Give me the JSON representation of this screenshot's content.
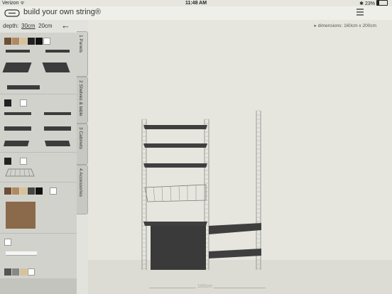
{
  "status": {
    "carrier": "Verizon",
    "time": "11:48 AM",
    "battery": "23%",
    "battery_fraction": 0.23
  },
  "app": {
    "title": "build your own string®"
  },
  "sidebar": {
    "depth_label": "depth:",
    "depth_options": [
      "30cm",
      "20cm"
    ],
    "selected_depth": "30cm"
  },
  "tabs": [
    {
      "label": "1 Panels"
    },
    {
      "label": "2 Shelves & table"
    },
    {
      "label": "3 Cabinets"
    },
    {
      "label": "4 Accessories"
    }
  ],
  "canvas": {
    "dimensions": "dimensions: 160cm x 200cm",
    "width_label": "160cm"
  },
  "colors": {
    "accent": "#3c3c3c",
    "wood": "#8a6a4a",
    "background": "#e6e6df"
  },
  "icons": {
    "back": "back-arrow-icon",
    "menu": "menu-icon",
    "logo": "string-logo-icon"
  }
}
